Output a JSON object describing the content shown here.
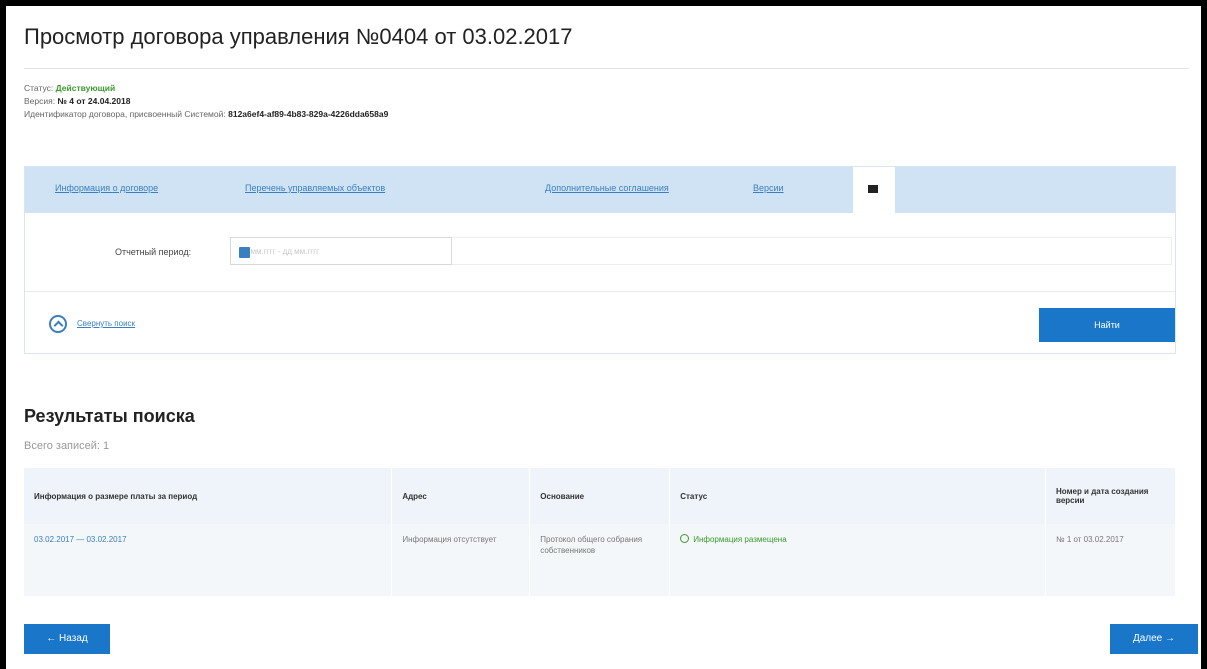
{
  "page": {
    "title": "Просмотр договора управления №0404 от 03.02.2017"
  },
  "meta": {
    "status_label": "Статус:",
    "status_value": "Действующий",
    "version_label": "Версия:",
    "version_value": "№ 4 от 24.04.2018",
    "id_label": "Идентификатор договора, присвоенный Системой:",
    "id_value": "812a6ef4-af89-4b83-829a-4226dda658a9"
  },
  "tabs": [
    {
      "label": "Информация о договоре"
    },
    {
      "label": "Перечень управляемых объектов"
    },
    {
      "label": "Дополнительные соглашения"
    },
    {
      "label": "Версии"
    }
  ],
  "filter": {
    "period_label": "Отчетный период:",
    "period_placeholder": "дд.мм.гггг - дд.мм.гггг",
    "collapse_label": "Свернуть поиск",
    "find_label": "Найти"
  },
  "results": {
    "title": "Результаты поиска",
    "count": "Всего записей: 1",
    "columns": [
      "Информация о размере платы за период",
      "Адрес",
      "Основание",
      "Статус",
      "Номер и дата создания версии"
    ],
    "rows": [
      {
        "period": "03.02.2017 — 03.02.2017",
        "address": "Информация отсутствует",
        "basis": "Протокол общего собрания собственников",
        "status": "Информация размещена",
        "version": "№ 1 от 03.02.2017"
      }
    ]
  },
  "nav": {
    "back_label": "← Назад",
    "next_label": "Далее →"
  },
  "colors": {
    "accent": "#1a76c8",
    "tabbar": "#cfe3f4",
    "status_ok": "#3a9a2e"
  }
}
